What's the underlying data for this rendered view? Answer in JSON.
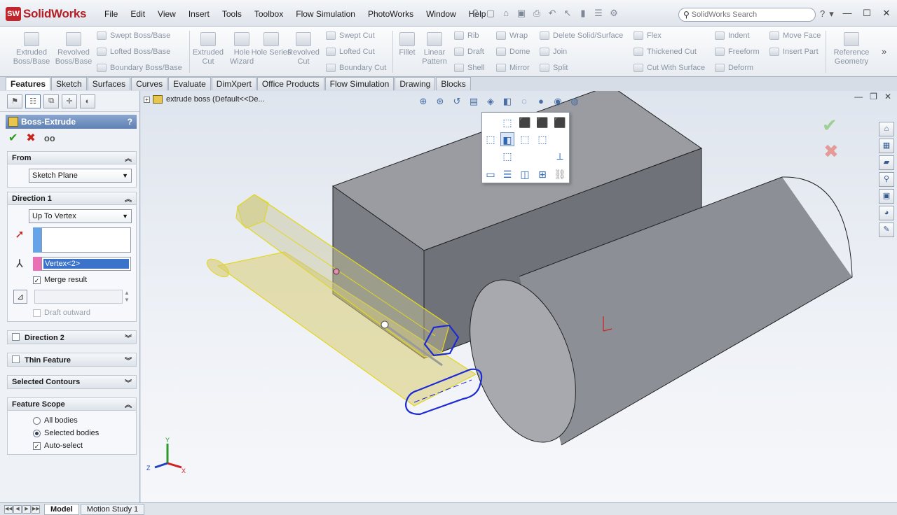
{
  "app": {
    "logo_mark": "SW",
    "logo_text": "SolidWorks",
    "accent": "#b21f24"
  },
  "menus": [
    "File",
    "Edit",
    "View",
    "Insert",
    "Tools",
    "Toolbox",
    "Flow Simulation",
    "PhotoWorks",
    "Window",
    "Help"
  ],
  "search": {
    "placeholder": "SolidWorks Search"
  },
  "commands": {
    "extruded_boss": "Extruded Boss/Base",
    "revolved_boss": "Revolved Boss/Base",
    "swept_boss": "Swept Boss/Base",
    "lofted_boss": "Lofted Boss/Base",
    "boundary_boss": "Boundary Boss/Base",
    "extruded_cut": "Extruded Cut",
    "hole_wizard": "Hole Wizard",
    "hole_series": "Hole Series",
    "revolved_cut": "Revolved Cut",
    "swept_cut": "Swept Cut",
    "lofted_cut": "Lofted Cut",
    "boundary_cut": "Boundary Cut",
    "fillet": "Fillet",
    "linear_pattern": "Linear Pattern",
    "rib": "Rib",
    "draft": "Draft",
    "shell": "Shell",
    "wrap": "Wrap",
    "dome": "Dome",
    "mirror": "Mirror",
    "delete_solid": "Delete Solid/Surface",
    "join": "Join",
    "split": "Split",
    "flex": "Flex",
    "thickened_cut": "Thickened Cut",
    "cut_with_surface": "Cut With Surface",
    "indent": "Indent",
    "freeform": "Freeform",
    "deform": "Deform",
    "move_face": "Move Face",
    "insert_part": "Insert Part",
    "reference_geometry": "Reference Geometry"
  },
  "tabs": [
    "Features",
    "Sketch",
    "Surfaces",
    "Curves",
    "Evaluate",
    "DimXpert",
    "Office Products",
    "Flow Simulation",
    "Drawing",
    "Blocks"
  ],
  "property_manager": {
    "title": "Boss-Extrude",
    "help": "?",
    "from": {
      "label": "From",
      "value": "Sketch Plane"
    },
    "direction1": {
      "label": "Direction 1",
      "end_condition": "Up To Vertex",
      "vertex": "Vertex<2>",
      "merge_result": "Merge result",
      "draft_outward": "Draft outward"
    },
    "direction2": {
      "label": "Direction 2"
    },
    "thin_feature": {
      "label": "Thin Feature"
    },
    "selected_contours": {
      "label": "Selected Contours"
    },
    "feature_scope": {
      "label": "Feature Scope",
      "all_bodies": "All bodies",
      "selected_bodies": "Selected bodies",
      "auto_select": "Auto-select"
    }
  },
  "viewport": {
    "tree_flyout": "extrude boss  (Default<<De..."
  },
  "triad": {
    "x": "X",
    "y": "Y",
    "z": "Z"
  },
  "bottom_tabs": [
    "Model",
    "Motion Study 1"
  ]
}
